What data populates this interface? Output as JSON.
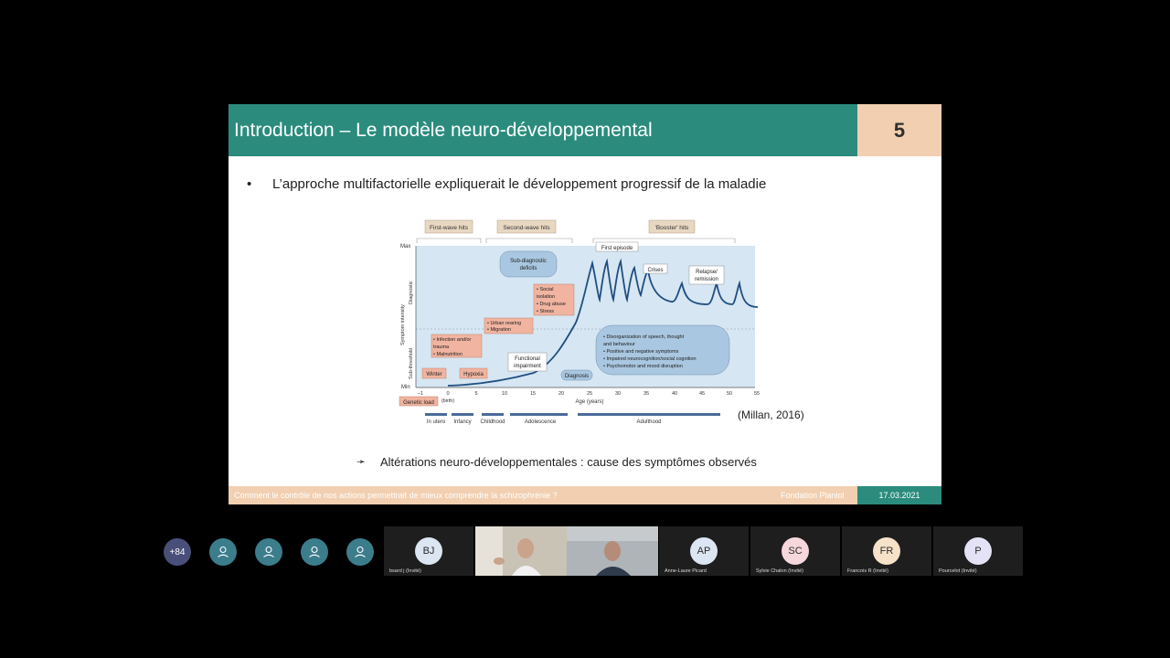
{
  "slide": {
    "title": "Introduction – Le modèle neuro-développemental",
    "number": "5",
    "bullet_symbol": "•",
    "bullet": "L’approche multifactorielle expliquerait le développement progressif de la maladie",
    "citation": "(Millan, 2016)",
    "arrow_symbol": "➛",
    "sub_point": "Altérations neuro-développementales : cause des symptômes observés",
    "footer_left": "Comment le contrôle de nos actions permettrait de mieux comprendre la schizophrénie ?",
    "footer_mid": "Fondation Planiol",
    "footer_date": "17.03.2021"
  },
  "figure": {
    "hits": [
      "First-wave hits",
      "Second-wave hits",
      "'Booster' hits"
    ],
    "y_axis_ticks": [
      "Max",
      "Min"
    ],
    "y_axis_label": "Symptom intensity",
    "y_bands": [
      "Diagnostic",
      "Sub-threshold"
    ],
    "x_ticks": [
      "–1",
      "0",
      "5",
      "10",
      "15",
      "20",
      "25",
      "30",
      "35",
      "40",
      "45",
      "50",
      "55"
    ],
    "birth_label": "(birth)",
    "x_label": "Age (years)",
    "stages": [
      "In utero",
      "Infancy",
      "Childhood",
      "Adolescence",
      "Adulthood"
    ],
    "labels": {
      "sub_diagnostic": "Sub-diagnostic deficits",
      "sub_diagnostic_1": "Sub-diagnostic",
      "sub_diagnostic_2": "deficits",
      "first_episode": "First episode",
      "crises": "Crises",
      "relapse_1": "Relapse/",
      "relapse_2": "remission",
      "social": [
        "• Social",
        "  isolation",
        "• Drug abuse",
        "• Stress"
      ],
      "urban": [
        "• Urban rearing",
        "• Migration"
      ],
      "infection": [
        "• Infection and/or",
        "  trauma",
        "• Malnutrition"
      ],
      "winter": "Winter",
      "hypoxia": "Hypoxia",
      "genetic": "Genetic load",
      "functional_1": "Functional",
      "functional_2": "impairment",
      "diagnosis": "Diagnosis",
      "symptoms": [
        "• Disorganization of speech, thought",
        "  and behaviour",
        "• Positive and negative symptoms",
        "• Impaired neurocognition/social cognition",
        "• Psychomotor and mood disruption"
      ]
    }
  },
  "participants": {
    "more": "+84",
    "tiles": [
      {
        "initials": "BJ",
        "name": "bsard j (Invité)",
        "color": "#dbe6f2"
      },
      {
        "initials": "AP",
        "name": "Anne-Laure Picard",
        "color": "#dbe6f2"
      },
      {
        "initials": "SC",
        "name": "Sylvie Chalon (Invité)",
        "color": "#f6d7dc"
      },
      {
        "initials": "FR",
        "name": "Francois R (Invité)",
        "color": "#f5e2c9"
      },
      {
        "initials": "P",
        "name": "Pourcelot (Invité)",
        "color": "#e3e3f5"
      }
    ]
  },
  "colors": {
    "teal": "#2b8c7e",
    "peach": "#f1cfb0",
    "curve": "#1f4e80",
    "panel": "#d6e6f2"
  }
}
